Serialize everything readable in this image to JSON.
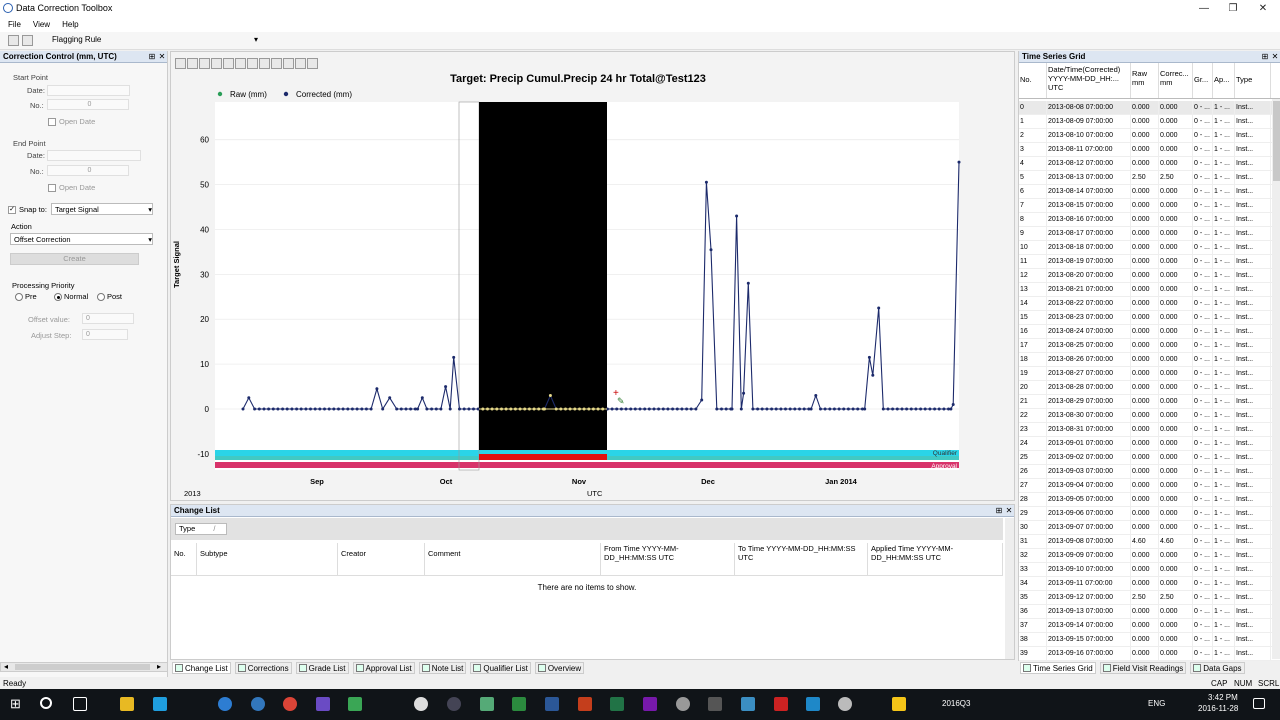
{
  "window": {
    "title": "Data Correction Toolbox",
    "minimize": "—",
    "restore": "❐",
    "close": "✕"
  },
  "menu": [
    "File",
    "View",
    "Help"
  ],
  "toolbar": {
    "flagging_rule_label": "Flagging Rule",
    "dropdown_arrow": "▾"
  },
  "left_panel": {
    "title": "Correction Control (mm, UTC)",
    "pin": "⊞",
    "close": "✕",
    "start_point": {
      "label": "Start Point",
      "date_label": "Date:",
      "no_label": "No.:",
      "no_value": "0",
      "open_date": "Open Date"
    },
    "end_point": {
      "label": "End Point",
      "date_label": "Date:",
      "no_label": "No.:",
      "no_value": "0",
      "open_date": "Open Date"
    },
    "snap_to": {
      "label": "Snap to:",
      "value": "Target Signal",
      "checked": "✓"
    },
    "action": {
      "label": "Action",
      "value": "Offset Correction"
    },
    "create_button": "Create",
    "processing_priority": {
      "label": "Processing Priority",
      "options": [
        "Pre",
        "Normal",
        "Post"
      ],
      "selected": "Normal"
    },
    "offset_value": {
      "label": "Offset value:",
      "value": "0"
    },
    "adjust_step": {
      "label": "Adjust Step:",
      "value": "0"
    },
    "scroll_right": "▸",
    "scroll_left": "◂"
  },
  "chart_data": {
    "type": "line",
    "title": "Target: Precip Cumul.Precip 24 hr Total@Test123",
    "ylabel": "Target Signal",
    "xlabel": "UTC",
    "year_label": "2013",
    "ylim": [
      -10,
      65
    ],
    "yticks": [
      "60",
      "50",
      "40",
      "30",
      "20",
      "10",
      "0",
      "-10"
    ],
    "xticks": [
      "Sep",
      "Oct",
      "Nov",
      "Dec",
      "Jan 2014"
    ],
    "legend": [
      {
        "name": "Raw (mm)",
        "color": "#2a9d58"
      },
      {
        "name": "Corrected (mm)",
        "color": "#1c2a6b"
      }
    ],
    "band_labels": [
      "Qualifier",
      "Approval"
    ],
    "series": [
      {
        "name": "Corrected (mm)",
        "points": [
          [
            0,
            0
          ],
          [
            5,
            2.5
          ],
          [
            10,
            0
          ],
          [
            110,
            0
          ],
          [
            115,
            4.5
          ],
          [
            120,
            0
          ],
          [
            126,
            2.5
          ],
          [
            132,
            0
          ],
          [
            150,
            0
          ],
          [
            154,
            2.5
          ],
          [
            158,
            0
          ],
          [
            170,
            0
          ],
          [
            174,
            5
          ],
          [
            178,
            0
          ],
          [
            181,
            11.5
          ],
          [
            186,
            0
          ],
          [
            259,
            0
          ],
          [
            264,
            3
          ],
          [
            269,
            0
          ],
          [
            389,
            0
          ],
          [
            394,
            2
          ],
          [
            398,
            50.5
          ],
          [
            402,
            35.5
          ],
          [
            407,
            0
          ],
          [
            420,
            0
          ],
          [
            424,
            43
          ],
          [
            428,
            0
          ],
          [
            430,
            3.5
          ],
          [
            434,
            28
          ],
          [
            438,
            0
          ],
          [
            488,
            0
          ],
          [
            492,
            3
          ],
          [
            496,
            0
          ],
          [
            534,
            0
          ],
          [
            538,
            11.5
          ],
          [
            541,
            7.5
          ],
          [
            546,
            22.5
          ],
          [
            550,
            0
          ],
          [
            608,
            0
          ],
          [
            610,
            1
          ],
          [
            615,
            55
          ]
        ]
      }
    ]
  },
  "time_series_grid": {
    "title": "Time Series Grid",
    "columns": [
      "No.",
      "Date/Time(Corrected) YYYY-MM-DD_HH:... UTC",
      "Raw mm",
      "Correc... mm",
      "Gr...",
      "Ap...",
      "Type"
    ],
    "rows": [
      [
        "0",
        "2013-08-08 07:00:00",
        "0.000",
        "0.000",
        "0 - ...",
        "1 - ...",
        "Inst..."
      ],
      [
        "1",
        "2013-08-09 07:00:00",
        "0.000",
        "0.000",
        "0 - ...",
        "1 - ...",
        "Inst..."
      ],
      [
        "2",
        "2013-08-10 07:00:00",
        "0.000",
        "0.000",
        "0 - ...",
        "1 - ...",
        "Inst..."
      ],
      [
        "3",
        "2013-08-11 07:00:00",
        "0.000",
        "0.000",
        "0 - ...",
        "1 - ...",
        "Inst..."
      ],
      [
        "4",
        "2013-08-12 07:00:00",
        "0.000",
        "0.000",
        "0 - ...",
        "1 - ...",
        "Inst..."
      ],
      [
        "5",
        "2013-08-13 07:00:00",
        "2.50",
        "2.50",
        "0 - ...",
        "1 - ...",
        "Inst..."
      ],
      [
        "6",
        "2013-08-14 07:00:00",
        "0.000",
        "0.000",
        "0 - ...",
        "1 - ...",
        "Inst..."
      ],
      [
        "7",
        "2013-08-15 07:00:00",
        "0.000",
        "0.000",
        "0 - ...",
        "1 - ...",
        "Inst..."
      ],
      [
        "8",
        "2013-08-16 07:00:00",
        "0.000",
        "0.000",
        "0 - ...",
        "1 - ...",
        "Inst..."
      ],
      [
        "9",
        "2013-08-17 07:00:00",
        "0.000",
        "0.000",
        "0 - ...",
        "1 - ...",
        "Inst..."
      ],
      [
        "10",
        "2013-08-18 07:00:00",
        "0.000",
        "0.000",
        "0 - ...",
        "1 - ...",
        "Inst..."
      ],
      [
        "11",
        "2013-08-19 07:00:00",
        "0.000",
        "0.000",
        "0 - ...",
        "1 - ...",
        "Inst..."
      ],
      [
        "12",
        "2013-08-20 07:00:00",
        "0.000",
        "0.000",
        "0 - ...",
        "1 - ...",
        "Inst..."
      ],
      [
        "13",
        "2013-08-21 07:00:00",
        "0.000",
        "0.000",
        "0 - ...",
        "1 - ...",
        "Inst..."
      ],
      [
        "14",
        "2013-08-22 07:00:00",
        "0.000",
        "0.000",
        "0 - ...",
        "1 - ...",
        "Inst..."
      ],
      [
        "15",
        "2013-08-23 07:00:00",
        "0.000",
        "0.000",
        "0 - ...",
        "1 - ...",
        "Inst..."
      ],
      [
        "16",
        "2013-08-24 07:00:00",
        "0.000",
        "0.000",
        "0 - ...",
        "1 - ...",
        "Inst..."
      ],
      [
        "17",
        "2013-08-25 07:00:00",
        "0.000",
        "0.000",
        "0 - ...",
        "1 - ...",
        "Inst..."
      ],
      [
        "18",
        "2013-08-26 07:00:00",
        "0.000",
        "0.000",
        "0 - ...",
        "1 - ...",
        "Inst..."
      ],
      [
        "19",
        "2013-08-27 07:00:00",
        "0.000",
        "0.000",
        "0 - ...",
        "1 - ...",
        "Inst..."
      ],
      [
        "20",
        "2013-08-28 07:00:00",
        "0.000",
        "0.000",
        "0 - ...",
        "1 - ...",
        "Inst..."
      ],
      [
        "21",
        "2013-08-29 07:00:00",
        "0.000",
        "0.000",
        "0 - ...",
        "1 - ...",
        "Inst..."
      ],
      [
        "22",
        "2013-08-30 07:00:00",
        "0.000",
        "0.000",
        "0 - ...",
        "1 - ...",
        "Inst..."
      ],
      [
        "23",
        "2013-08-31 07:00:00",
        "0.000",
        "0.000",
        "0 - ...",
        "1 - ...",
        "Inst..."
      ],
      [
        "24",
        "2013-09-01 07:00:00",
        "0.000",
        "0.000",
        "0 - ...",
        "1 - ...",
        "Inst..."
      ],
      [
        "25",
        "2013-09-02 07:00:00",
        "0.000",
        "0.000",
        "0 - ...",
        "1 - ...",
        "Inst..."
      ],
      [
        "26",
        "2013-09-03 07:00:00",
        "0.000",
        "0.000",
        "0 - ...",
        "1 - ...",
        "Inst..."
      ],
      [
        "27",
        "2013-09-04 07:00:00",
        "0.000",
        "0.000",
        "0 - ...",
        "1 - ...",
        "Inst..."
      ],
      [
        "28",
        "2013-09-05 07:00:00",
        "0.000",
        "0.000",
        "0 - ...",
        "1 - ...",
        "Inst..."
      ],
      [
        "29",
        "2013-09-06 07:00:00",
        "0.000",
        "0.000",
        "0 - ...",
        "1 - ...",
        "Inst..."
      ],
      [
        "30",
        "2013-09-07 07:00:00",
        "0.000",
        "0.000",
        "0 - ...",
        "1 - ...",
        "Inst..."
      ],
      [
        "31",
        "2013-09-08 07:00:00",
        "4.60",
        "4.60",
        "0 - ...",
        "1 - ...",
        "Inst..."
      ],
      [
        "32",
        "2013-09-09 07:00:00",
        "0.000",
        "0.000",
        "0 - ...",
        "1 - ...",
        "Inst..."
      ],
      [
        "33",
        "2013-09-10 07:00:00",
        "0.000",
        "0.000",
        "0 - ...",
        "1 - ...",
        "Inst..."
      ],
      [
        "34",
        "2013-09-11 07:00:00",
        "0.000",
        "0.000",
        "0 - ...",
        "1 - ...",
        "Inst..."
      ],
      [
        "35",
        "2013-09-12 07:00:00",
        "2.50",
        "2.50",
        "0 - ...",
        "1 - ...",
        "Inst..."
      ],
      [
        "36",
        "2013-09-13 07:00:00",
        "0.000",
        "0.000",
        "0 - ...",
        "1 - ...",
        "Inst..."
      ],
      [
        "37",
        "2013-09-14 07:00:00",
        "0.000",
        "0.000",
        "0 - ...",
        "1 - ...",
        "Inst..."
      ],
      [
        "38",
        "2013-09-15 07:00:00",
        "0.000",
        "0.000",
        "0 - ...",
        "1 - ...",
        "Inst..."
      ],
      [
        "39",
        "2013-09-16 07:00:00",
        "0.000",
        "0.000",
        "0 - ...",
        "1 - ...",
        "Inst..."
      ]
    ],
    "tabs": [
      "Time Series Grid",
      "Field Visit Readings",
      "Data Gaps"
    ]
  },
  "change_list": {
    "title": "Change List",
    "filter_chip": "Type",
    "filter_close": "/",
    "columns": [
      "No.",
      "Subtype",
      "Creator",
      "Comment",
      "From Time YYYY-MM-DD_HH:MM:SS UTC",
      "To Time YYYY-MM-DD_HH:MM:SS UTC",
      "Applied Time YYYY-MM-DD_HH:MM:SS UTC"
    ],
    "empty_message": "There are no items to show."
  },
  "bottom_tabs": [
    "Change List",
    "Corrections",
    "Grade List",
    "Approval List",
    "Note List",
    "Qualifier List",
    "Overview"
  ],
  "status": {
    "text": "Ready",
    "indicators": [
      "CAP",
      "NUM",
      "SCRL"
    ]
  },
  "taskbar": {
    "tray_label": "2016Q3",
    "lang": "ENG",
    "time": "3:42 PM",
    "date": "2016-11-28"
  }
}
